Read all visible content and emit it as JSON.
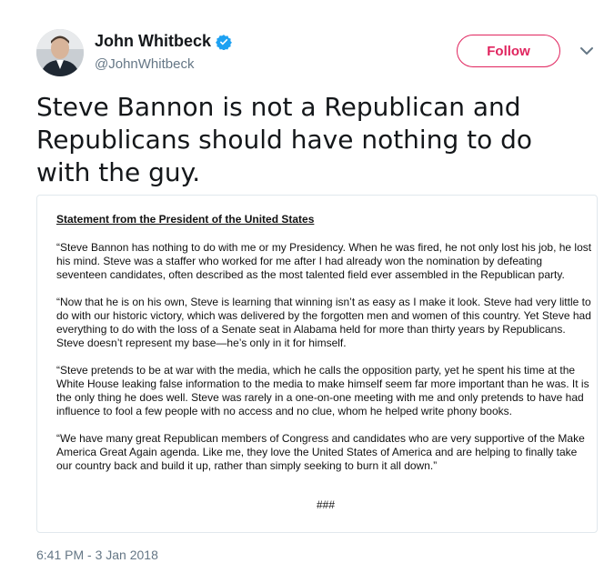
{
  "author": {
    "name": "John Whitbeck",
    "handle": "@JohnWhitbeck",
    "verified_icon": "verified-badge-icon"
  },
  "follow_label": "Follow",
  "tweet_text": "Steve Bannon is not a Republican and Republicans should have nothing to do with the guy.",
  "statement": {
    "title": "Statement from the President of the United States",
    "paragraphs": [
      "“Steve Bannon has nothing to do with me or my Presidency. When he was fired, he not only lost his job, he lost his mind. Steve was a staffer who worked for me after I had already won the nomination by defeating seventeen candidates, often described as the most talented field ever assembled in the Republican party.",
      "“Now that he is on his own, Steve is learning that winning isn’t as easy as I make it look. Steve had very little to do with our historic victory, which was delivered by the forgotten men and women of this country. Yet Steve had everything to do with the loss of a Senate seat in Alabama held for more than thirty years by Republicans. Steve doesn’t represent my base—he’s only in it for himself.",
      "“Steve pretends to be at war with the media, which he calls the opposition party, yet he spent his time at the White House leaking false information to the media to make himself seem far more important than he was. It is the only thing he does well. Steve was rarely in a one-on-one meeting with me and only pretends to have had influence to fool a few people with no access and no clue, whom he helped write phony books.",
      "“We have many great Republican members of Congress and candidates who are very supportive of the Make America Great Again agenda. Like me, they love the United States of America and are helping to finally take our country back and build it up, rather than simply seeking to burn it all down.”"
    ],
    "end_mark": "###"
  },
  "timestamp": "6:41 PM - 3 Jan 2018",
  "colors": {
    "accent": "#e0245e",
    "verified": "#1da1f2",
    "muted": "#657786"
  }
}
